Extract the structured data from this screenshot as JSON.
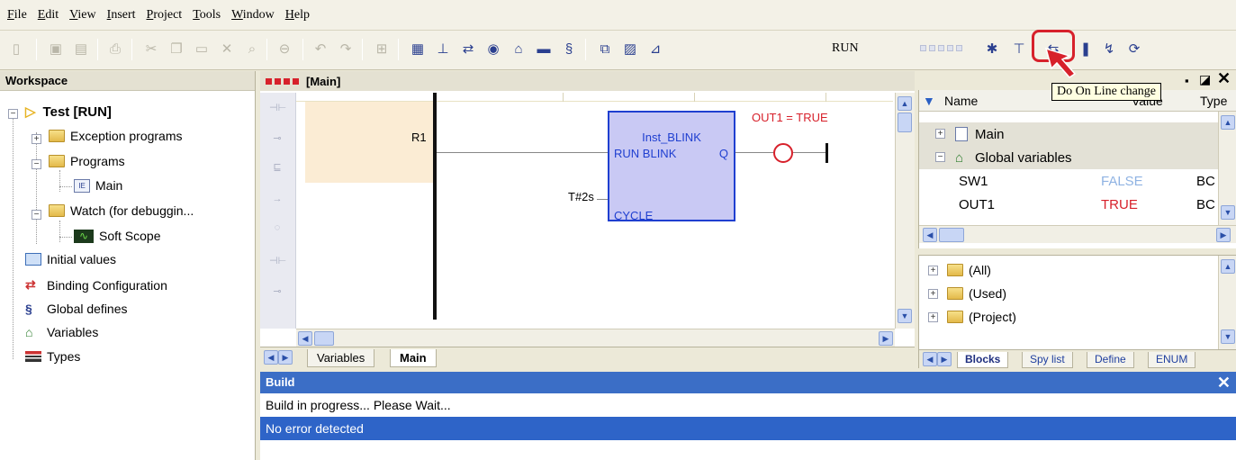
{
  "menu": [
    "File",
    "Edit",
    "View",
    "Insert",
    "Project",
    "Tools",
    "Window",
    "Help"
  ],
  "toolbar": {
    "mode": "RUN",
    "tooltip": "Do On Line change",
    "highlight_color": "#d7212b"
  },
  "workspace": {
    "title": "Workspace",
    "root": "Test [RUN]",
    "items": [
      {
        "label": "Exception programs",
        "icon": "folder-icon"
      },
      {
        "label": "Programs",
        "icon": "folder-icon"
      },
      {
        "label": "Main",
        "icon": "program-icon"
      },
      {
        "label": "Watch (for debuggin...",
        "icon": "folder-icon"
      },
      {
        "label": "Soft Scope",
        "icon": "scope-icon"
      },
      {
        "label": "Initial values",
        "icon": "table-icon"
      },
      {
        "label": "Binding Configuration",
        "icon": "binding-icon"
      },
      {
        "label": "Global defines",
        "icon": "defines-icon"
      },
      {
        "label": "Variables",
        "icon": "variables-icon"
      },
      {
        "label": "Types",
        "icon": "types-icon"
      }
    ]
  },
  "editor": {
    "title": "[Main]",
    "contact_label": "R1",
    "block_instance": "Inst_BLINK",
    "block_input": "RUN",
    "block_type": "BLINK",
    "block_output": "Q",
    "block_cycle_input": "CYCLE",
    "cycle_value": "T#2s",
    "coil_label": "OUT1 = TRUE",
    "tabs": [
      "Variables",
      "Main"
    ]
  },
  "variables": {
    "headers": [
      "Name",
      "Value",
      "Type"
    ],
    "rows": [
      {
        "name": "Main",
        "value": "",
        "type": ""
      },
      {
        "name": "Global variables",
        "value": "",
        "type": ""
      },
      {
        "name": "SW1",
        "value": "FALSE",
        "type": "BC"
      },
      {
        "name": "OUT1",
        "value": "TRUE",
        "type": "BC"
      }
    ],
    "false_color": "#8fb3e3",
    "true_color": "#d7212b"
  },
  "blocks": {
    "items": [
      "(All)",
      "(Used)",
      "(Project)"
    ],
    "tabs": [
      "Blocks",
      "Spy list",
      "Define",
      "ENUM"
    ]
  },
  "build": {
    "title": "Build",
    "lines": [
      "Build in progress... Please Wait...",
      "No error detected"
    ]
  }
}
